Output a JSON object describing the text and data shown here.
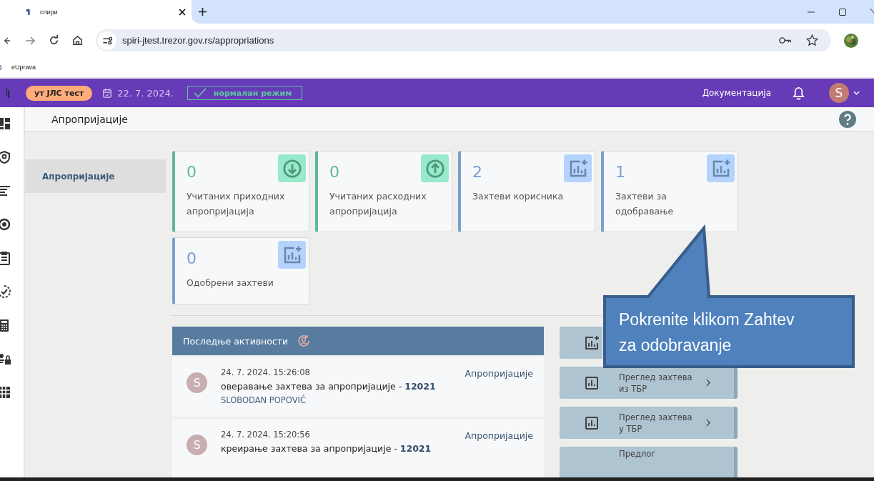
{
  "browser": {
    "tab_title": "спири",
    "url": "spiri-jtest.trezor.gov.rs/appropriations",
    "bookmarks": [
      {
        "label": "eUprava"
      }
    ]
  },
  "header": {
    "environment": "ут ЈЛС тест",
    "date": "22. 7. 2024.",
    "mode": "нормалан режим",
    "documentation": "Документација",
    "user_initial": "S"
  },
  "page_title": "Апропријације",
  "sidebar": {
    "items": [
      {
        "label": "Апропријације",
        "selected": true
      }
    ]
  },
  "cards": [
    {
      "kind": "income",
      "value": "0",
      "label": "Учитаних приходних апропријација",
      "color": "#5fb89a"
    },
    {
      "kind": "expense",
      "value": "0",
      "label": "Учитаних расходних апропријација",
      "color": "#5fb89a"
    },
    {
      "kind": "request",
      "value": "2",
      "label": "Захтеви корисника",
      "color": "#7b9fd0"
    },
    {
      "kind": "request",
      "value": "1",
      "label": "Захтеви за одобравање",
      "color": "#7b9fd0"
    },
    {
      "kind": "request",
      "value": "0",
      "label": "Одобрени захтеви",
      "color": "#7b9fd0"
    }
  ],
  "activities": {
    "title": "Последње активности",
    "items": [
      {
        "initial": "S",
        "time": "24. 7. 2024. 15:26:08",
        "action": "оверавање захтева за апропријације - **12021**",
        "module": "Апропријације",
        "user": "SLOBODAN POPOVIĆ"
      },
      {
        "initial": "S",
        "time": "24. 7. 2024. 15:20:56",
        "action": "креирање захтева за апропријације - **12021**",
        "module": "Апропријације"
      }
    ]
  },
  "actions": [
    {
      "kind": "create"
    },
    {
      "kind": "review",
      "label": "Преглед захтева из ТБР"
    },
    {
      "kind": "review",
      "label": "Преглед захтева у ТБР"
    },
    {
      "kind": "proposal",
      "label": "Предлог"
    }
  ],
  "callout": {
    "text": "Pokrenite klikom Zahtev za odobravanje"
  }
}
